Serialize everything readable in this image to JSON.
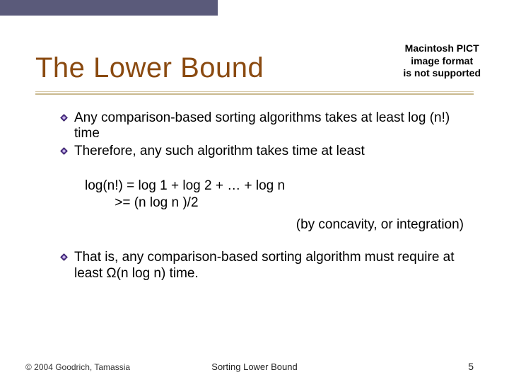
{
  "topbar": {},
  "pict": {
    "l1": "Macintosh PICT",
    "l2": "image format",
    "l3": "is not supported"
  },
  "title": "The Lower Bound",
  "bullets": {
    "b1": "Any comparison-based sorting algorithms takes at least log (n!) time",
    "b2": "Therefore, any such algorithm takes time at least",
    "b3": "That is, any comparison-based sorting algorithm must require at least Ω(n log n) time."
  },
  "equation": {
    "line1": "log(n!) = log 1 + log 2 + … + log n",
    "line2": "        >= (n log n )/2",
    "by": "(by concavity, or integration)"
  },
  "footer": {
    "left": "© 2004 Goodrich, Tamassia",
    "center": "Sorting Lower Bound",
    "right": "5"
  }
}
